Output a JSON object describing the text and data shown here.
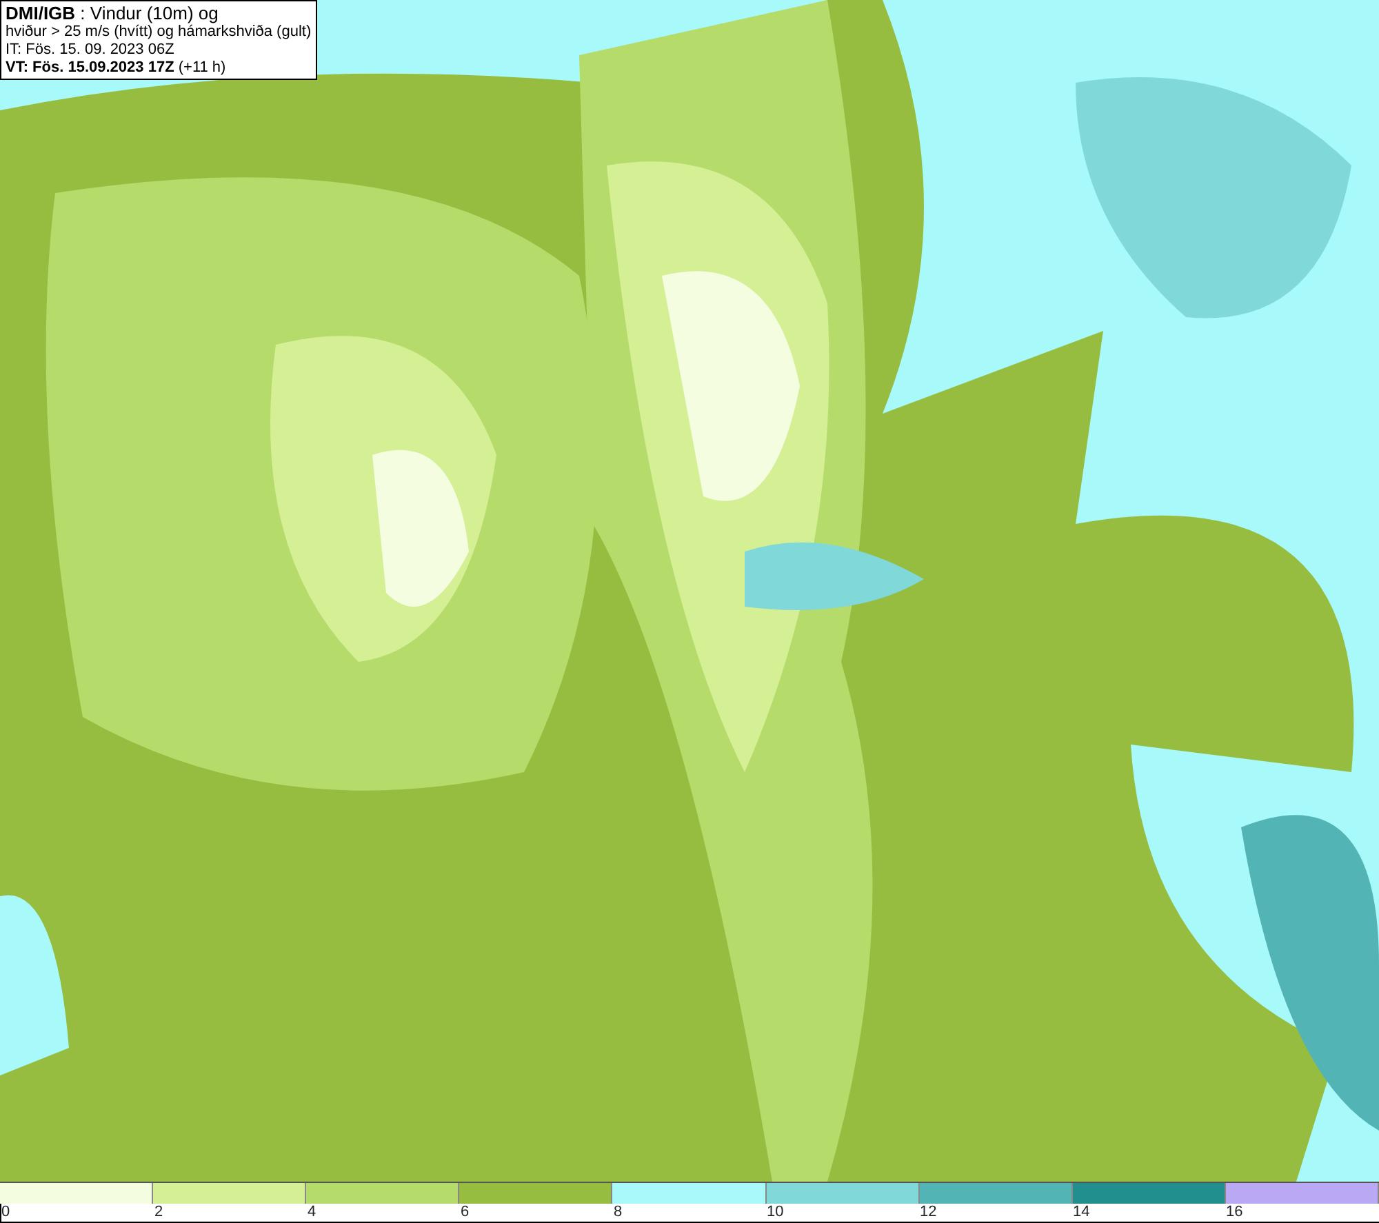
{
  "map": {
    "title_lines": [
      "**DMI/IGB** : Vindur (10m) og",
      "hviður > 25 m/s (hvítt) og hámarkshviða (gult)",
      "IT: Fös. 15. 09. 2023 06Z",
      "**VT: Fös. 15.09.2023 17Z** (+11 h)"
    ]
  },
  "legend": {
    "bins": [
      {
        "label": "0",
        "color": "#f4fde0"
      },
      {
        "label": "2",
        "color": "#d5ef95"
      },
      {
        "label": "4",
        "color": "#b5db6b"
      },
      {
        "label": "6",
        "color": "#97bd40"
      },
      {
        "label": "8",
        "color": "#a8f9f9"
      },
      {
        "label": "10",
        "color": "#80d8d8"
      },
      {
        "label": "12",
        "color": "#52b4b4"
      },
      {
        "label": "14",
        "color": "#228f8f"
      },
      {
        "label": "16",
        "color": "#bba8f5"
      }
    ]
  }
}
